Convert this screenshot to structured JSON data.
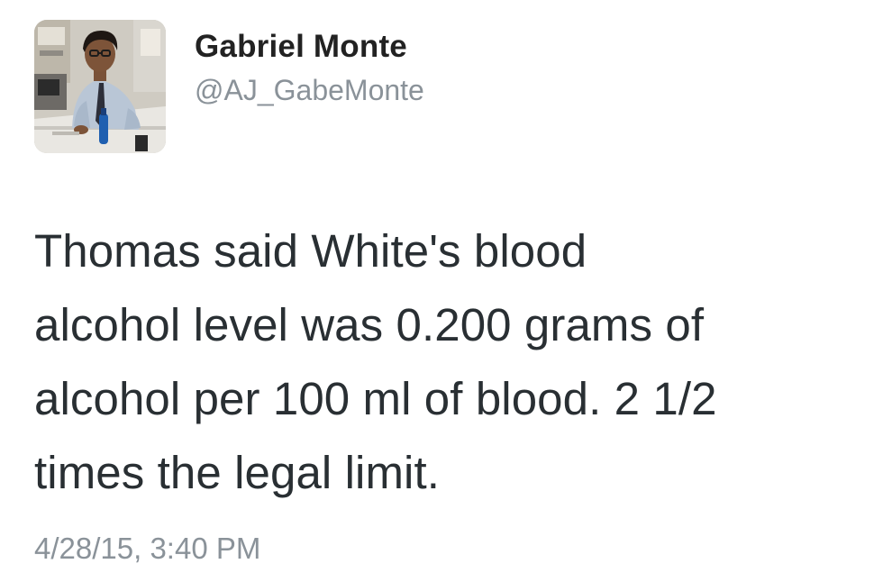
{
  "tweet": {
    "author": {
      "display_name": "Gabriel Monte",
      "handle": "@AJ_GabeMonte",
      "avatar": "profile-photo"
    },
    "text_lines": [
      "Thomas said White's blood",
      "alcohol level was 0.200 grams of",
      "alcohol per 100 ml of blood. 2 1/2",
      "times the legal limit."
    ],
    "timestamp": "4/28/15, 3:40 PM"
  }
}
